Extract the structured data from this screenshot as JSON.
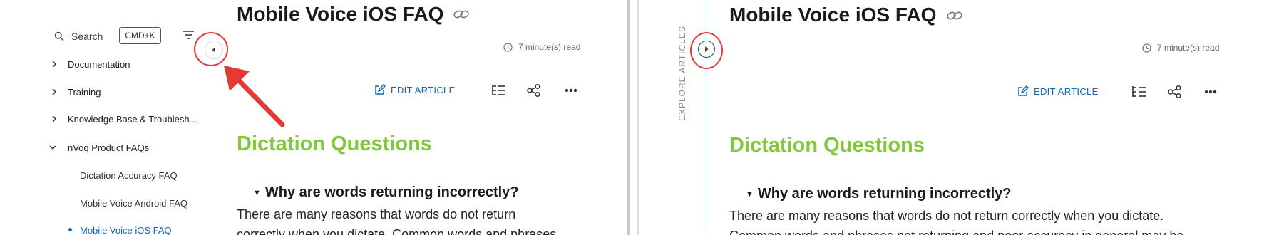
{
  "left": {
    "search": {
      "label": "Search",
      "shortcut": "CMD+K"
    },
    "nav": {
      "items": [
        {
          "label": "Documentation"
        },
        {
          "label": "Training"
        },
        {
          "label": "Knowledge Base & Troublesh..."
        },
        {
          "label": "nVoq Product FAQs"
        }
      ],
      "children": [
        {
          "label": "Dictation Accuracy FAQ"
        },
        {
          "label": "Mobile Voice Android FAQ"
        },
        {
          "label": "Mobile Voice iOS FAQ",
          "active": true
        }
      ]
    },
    "article": {
      "title": "Mobile Voice iOS FAQ",
      "read_time": "7 minute(s) read",
      "edit_label": "EDIT ARTICLE",
      "section": "Dictation Questions",
      "question": "Why are words returning incorrectly?",
      "body_line1": "There are many reasons that words do not return",
      "body_line2": "correctly when you dictate. Common words and phrases"
    }
  },
  "right": {
    "explore_label": "EXPLORE ARTICLES",
    "article": {
      "title": "Mobile Voice iOS FAQ",
      "read_time": "7 minute(s) read",
      "edit_label": "EDIT ARTICLE",
      "section": "Dictation Questions",
      "question": "Why are words returning incorrectly?",
      "body_line1": "There are many reasons that words do not return correctly when you dictate.",
      "body_line2": "Common words and phrases not returning and poor accuracy in general may be"
    }
  },
  "colors": {
    "accent_blue": "#1466b8",
    "section_green": "#82c83b",
    "annotation_red": "#e53935"
  },
  "icons": [
    "search-icon",
    "filter-icon",
    "collapse-arrow-icon",
    "expand-arrow-icon",
    "link-icon",
    "clock-icon",
    "edit-icon",
    "toc-icon",
    "share-icon",
    "more-icon",
    "chevron-right-icon",
    "chevron-down-icon"
  ]
}
